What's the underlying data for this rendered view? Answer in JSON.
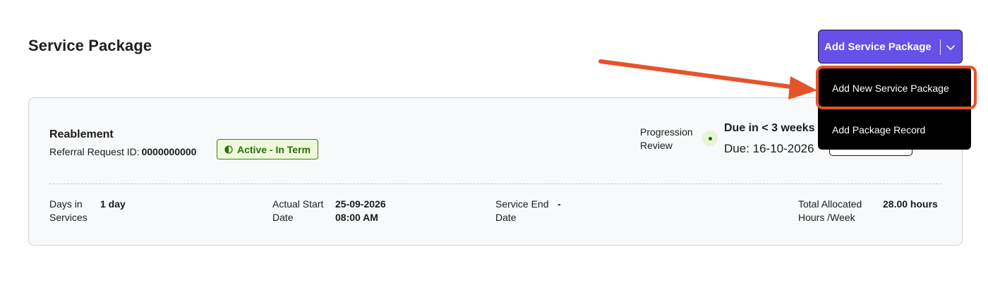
{
  "page": {
    "title": "Service Package"
  },
  "add_button": {
    "label": "Add Service Package",
    "icon": "chevron-down-icon"
  },
  "dropdown": {
    "items": [
      {
        "label": "Add New Service Package"
      },
      {
        "label": "Add Package Record"
      }
    ]
  },
  "package": {
    "name": "Reablement",
    "referral_label": "Referral Request ID:",
    "referral_id": "0000000000",
    "status": "Active - In Term",
    "progression": {
      "label": "Progression Review",
      "due_in": "Due in < 3 weeks",
      "due_date": "Due: 16-10-2026"
    },
    "stats": {
      "days_label": "Days in Services",
      "days_value": "1 day",
      "start_label": "Actual Start Date",
      "start_date": "25-09-2026",
      "start_time": "08:00 AM",
      "end_label": "Service End Date",
      "end_value": "-",
      "hours_label": "Total Allocated Hours /Week",
      "hours_value": "28.00 hours"
    }
  },
  "colors": {
    "accent": "#6650e8",
    "status_border": "#3f7d1a",
    "status_bg": "#eef9d8",
    "annotation": "#e5532b",
    "dropdown_bg": "#000000"
  }
}
